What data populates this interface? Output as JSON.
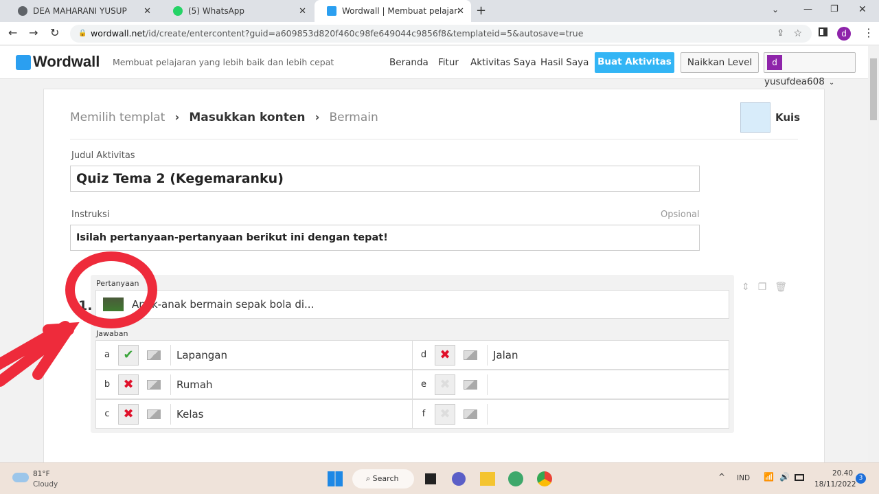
{
  "browser": {
    "tabs": [
      {
        "title": "DEA MAHARANI YUSUP",
        "icon": "globe-icon"
      },
      {
        "title": "(5) WhatsApp",
        "icon": "whatsapp-icon"
      },
      {
        "title": "Wordwall | Membuat pelajaran y",
        "icon": "wordwall-icon",
        "active": true
      }
    ],
    "url_domain": "wordwall.net",
    "url_path": "/id/create/entercontent?guid=a609853d820f460c98fe649044c9856f8&templateid=5&autosave=true",
    "profile_initial": "d"
  },
  "header": {
    "logo": "Wordwall",
    "tagline": "Membuat pelajaran yang lebih baik dan lebih cepat",
    "nav": [
      "Beranda",
      "Fitur",
      "Aktivitas Saya",
      "Hasil Saya"
    ],
    "create_button": "Buat Aktivitas",
    "upgrade_button": "Naikkan Level",
    "user": {
      "initial": "d",
      "name": "yusufdea608"
    },
    "accent": "#33b5f5"
  },
  "steps": {
    "items": [
      "Memilih templat",
      "Masukkan konten",
      "Bermain"
    ],
    "active": 1
  },
  "template": {
    "name": "Kuis"
  },
  "form": {
    "title_label": "Judul Aktivitas",
    "title_value": "Quiz Tema 2 (Kegemaranku)",
    "instr_label": "Instruksi",
    "instr_optional": "Opsional",
    "instr_value": "Isilah pertanyaan-pertanyaan berikut ini dengan tepat!"
  },
  "question": {
    "number": "1.",
    "label": "Pertanyaan",
    "text": "Anak-anak bermain sepak bola di...",
    "answers_label": "Jawaban",
    "answers": [
      {
        "letter": "a",
        "text": "Lapangan",
        "state": "correct"
      },
      {
        "letter": "b",
        "text": "Rumah",
        "state": "wrong"
      },
      {
        "letter": "c",
        "text": "Kelas",
        "state": "wrong"
      },
      {
        "letter": "d",
        "text": "Jalan",
        "state": "wrong"
      },
      {
        "letter": "e",
        "text": "",
        "state": "empty"
      },
      {
        "letter": "f",
        "text": "",
        "state": "empty"
      }
    ]
  },
  "taskbar": {
    "weather_temp": "81°F",
    "weather_desc": "Cloudy",
    "search": "Search",
    "lang": "IND",
    "time": "20.40",
    "date": "18/11/2022",
    "notif_count": "3"
  }
}
